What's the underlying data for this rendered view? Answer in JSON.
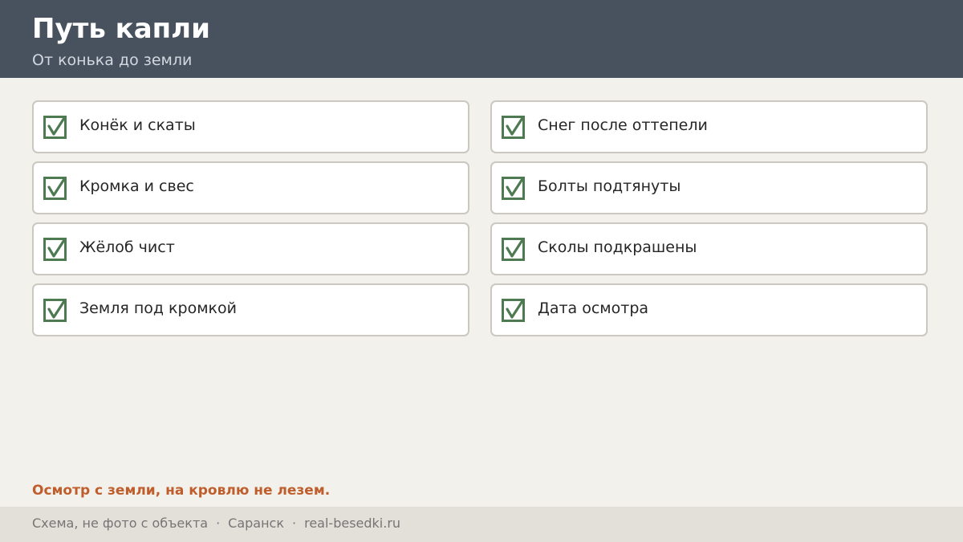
{
  "header": {
    "title": "Путь капли",
    "subtitle": "От конька до земли"
  },
  "checklist": {
    "items": [
      {
        "label": "Конёк и скаты",
        "checked": true
      },
      {
        "label": "Снег после оттепели",
        "checked": true
      },
      {
        "label": "Кромка и свес",
        "checked": true
      },
      {
        "label": "Болты подтянуты",
        "checked": true
      },
      {
        "label": "Жёлоб чист",
        "checked": true
      },
      {
        "label": "Сколы подкрашены",
        "checked": true
      },
      {
        "label": "Земля под кромкой",
        "checked": true
      },
      {
        "label": "Дата осмотра",
        "checked": true
      }
    ]
  },
  "warning": "Осмотр с земли, на кровлю не лезем.",
  "footer": {
    "note": "Схема, не фото с объекта",
    "separator": "·",
    "city": "Саранск",
    "site": "real-besedki.ru"
  },
  "colors": {
    "header_bg": "#48525e",
    "check_green": "#4e7a52",
    "warning_orange": "#bf5e2c",
    "page_bg": "#f3f1ec"
  }
}
